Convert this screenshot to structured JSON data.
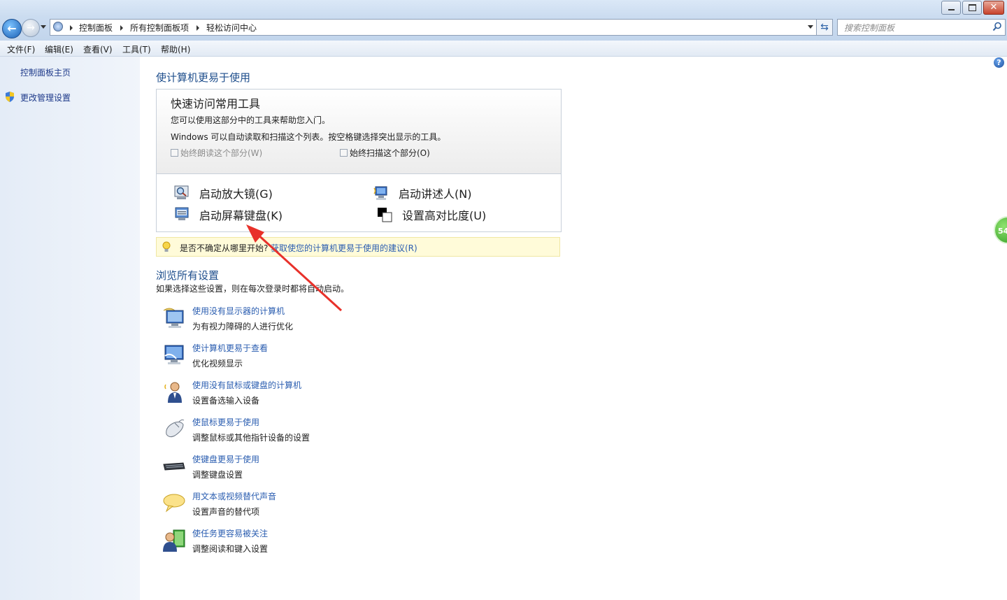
{
  "window": {
    "min_label": "",
    "max_label": "",
    "close_label": "✕"
  },
  "address": {
    "crumbs": [
      "控制面板",
      "所有控制面板项",
      "轻松访问中心"
    ],
    "search_placeholder": "搜索控制面板"
  },
  "menu": [
    "文件(F)",
    "编辑(E)",
    "查看(V)",
    "工具(T)",
    "帮助(H)"
  ],
  "sidebar": {
    "home": "控制面板主页",
    "admin": "更改管理设置"
  },
  "main": {
    "heading": "使计算机更易于使用",
    "quick_access": {
      "title": "快速访问常用工具",
      "line1": "您可以使用这部分中的工具来帮助您入门。",
      "line2": "Windows 可以自动读取和扫描这个列表。按空格键选择突出显示的工具。",
      "checkbox_read": "始终朗读这个部分(W)",
      "checkbox_scan": "始终扫描这个部分(O)",
      "tools": [
        "启动放大镜(G)",
        "启动讲述人(N)",
        "启动屏幕键盘(K)",
        "设置高对比度(U)"
      ]
    },
    "tip": {
      "text": "是否不确定从哪里开始?",
      "link": "获取使您的计算机更易于使用的建议(R)"
    },
    "browse_heading": "浏览所有设置",
    "browse_sub": "如果选择这些设置，则在每次登录时都将自动启动。",
    "settings": [
      {
        "link": "使用没有显示器的计算机",
        "desc": "为有视力障碍的人进行优化",
        "icon": "monitor-audio-icon"
      },
      {
        "link": "使计算机更易于查看",
        "desc": "优化视频显示",
        "icon": "monitor-icon"
      },
      {
        "link": "使用没有鼠标或键盘的计算机",
        "desc": "设置备选输入设备",
        "icon": "speaking-person-icon"
      },
      {
        "link": "使鼠标更易于使用",
        "desc": "调整鼠标或其他指针设备的设置",
        "icon": "mouse-icon"
      },
      {
        "link": "使键盘更易于使用",
        "desc": "调整键盘设置",
        "icon": "keyboard-icon"
      },
      {
        "link": "用文本或视频替代声音",
        "desc": "设置声音的替代项",
        "icon": "speech-bubble-icon"
      },
      {
        "link": "使任务更容易被关注",
        "desc": "调整阅读和键入设置",
        "icon": "person-focus-icon"
      }
    ]
  },
  "badge": {
    "value": "54"
  },
  "colors": {
    "link": "#2a5db0",
    "heading": "#1e4e8c",
    "annotation_arrow": "#e8312a"
  }
}
